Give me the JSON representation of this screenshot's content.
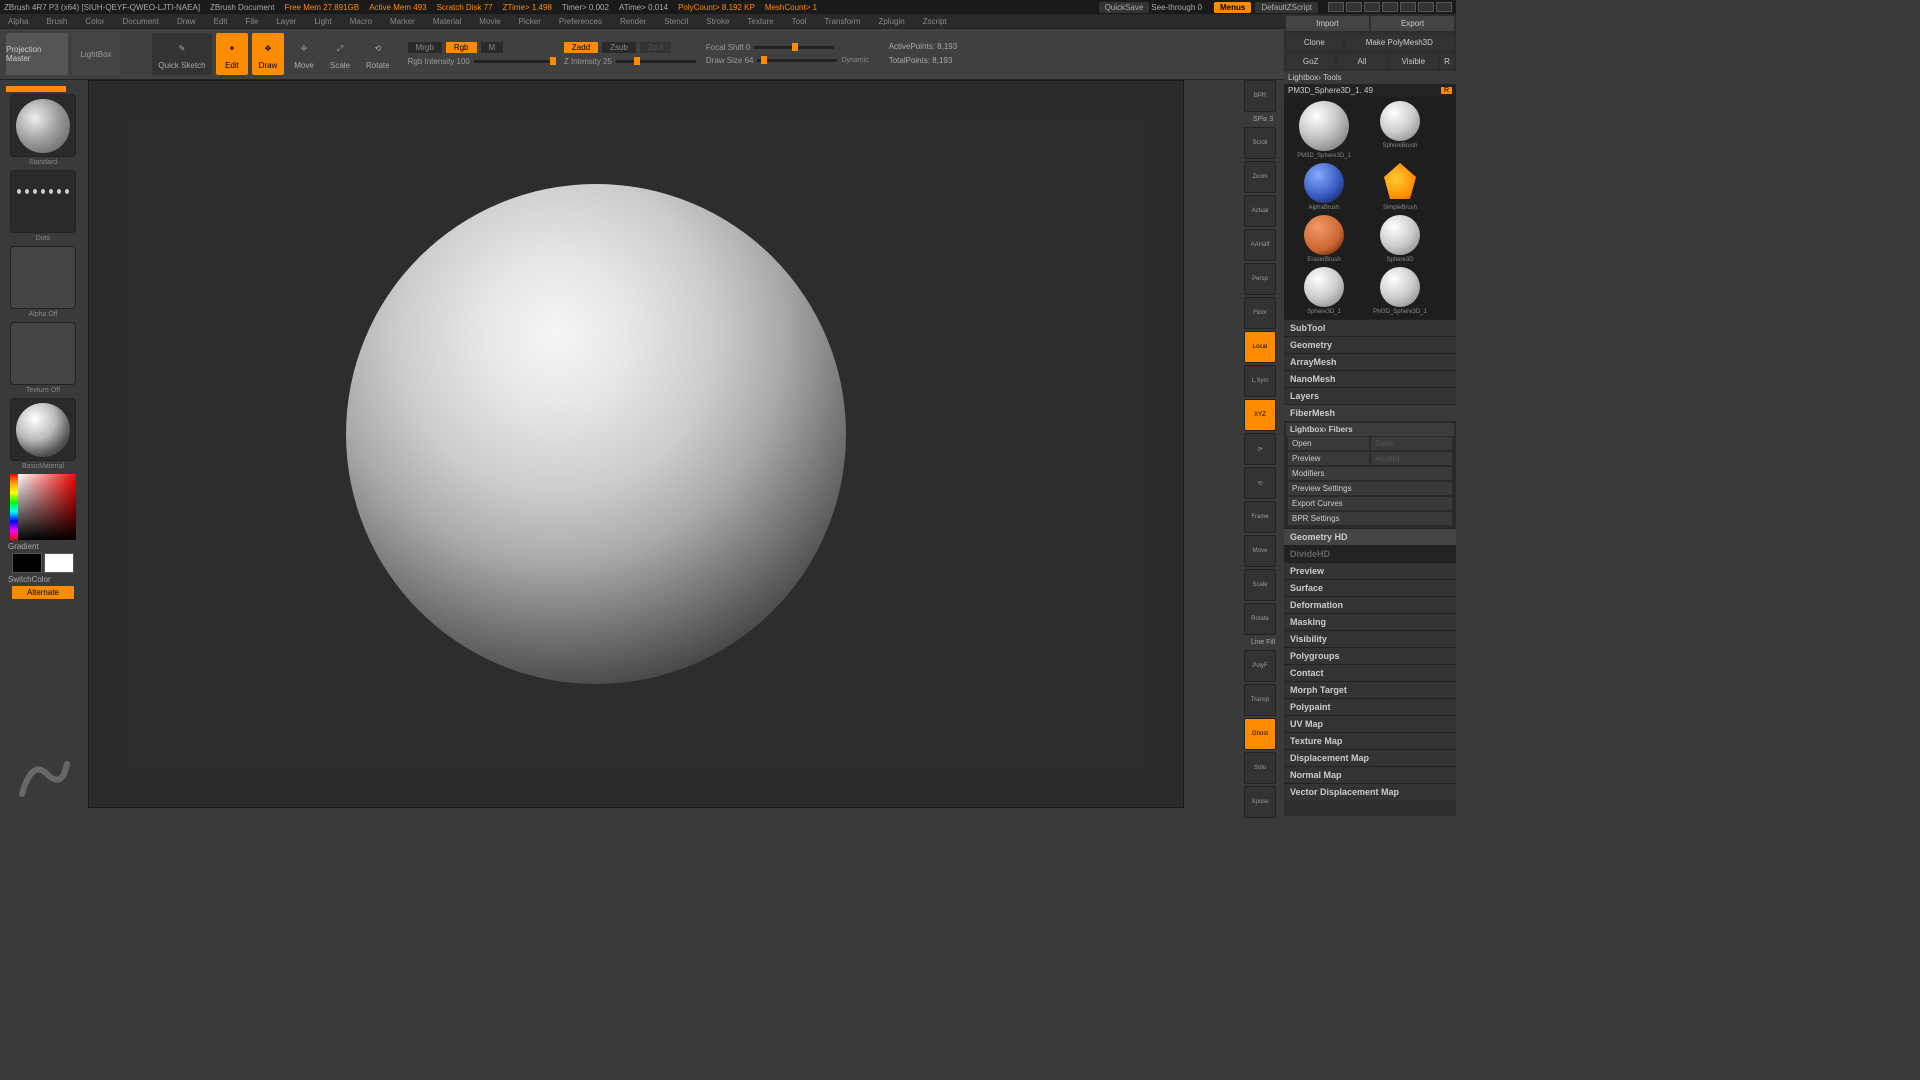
{
  "titlebar": {
    "app": "ZBrush 4R7 P3 (x64) [SIUH-QEYF-QWEO-LJTI-NAEA]",
    "doc": "ZBrush Document",
    "free_mem": "Free Mem 27.891GB",
    "active_mem": "Active Mem 493",
    "scratch": "Scratch Disk 77",
    "ztime": "ZTime> 1.498",
    "timer": "Timer> 0.002",
    "atime": "ATime> 0.014",
    "polycount": "PolyCount> 8.192 KP",
    "meshcount": "MeshCount> 1",
    "quicksave": "QuickSave",
    "seethrough": "See-through  0",
    "menus": "Menus",
    "defaultscript": "DefaultZScript"
  },
  "menu": [
    "Alpha",
    "Brush",
    "Color",
    "Document",
    "Draw",
    "Edit",
    "File",
    "Layer",
    "Light",
    "Macro",
    "Marker",
    "Material",
    "Movie",
    "Picker",
    "Preferences",
    "Render",
    "Stencil",
    "Stroke",
    "Texture",
    "Tool",
    "Transform",
    "Zplugin",
    "Zscript"
  ],
  "toolbar": {
    "projection_master": "Projection Master",
    "lightbox": "LightBox",
    "quick_sketch": "Quick Sketch",
    "edit": "Edit",
    "draw": "Draw",
    "move": "Move",
    "scale": "Scale",
    "rotate": "Rotate",
    "mrgb": "Mrgb",
    "rgb": "Rgb",
    "m": "M",
    "rgb_intensity_label": "Rgb Intensity 100",
    "zadd": "Zadd",
    "zsub": "Zsub",
    "zcut": "Zcut",
    "z_intensity_label": "Z Intensity 25",
    "focal_shift": "Focal Shift 0",
    "draw_size": "Draw Size 64",
    "dynamic": "Dynamic",
    "active_points": "ActivePoints: 8,193",
    "total_points": "TotalPoints: 8,193"
  },
  "leftpanel": {
    "brush_label": "Standard",
    "stroke_label": "Dots",
    "alpha_label": "Alpha Off",
    "texture_label": "Texture Off",
    "material_label": "BasicMaterial",
    "gradient": "Gradient",
    "switchcolor": "SwitchColor",
    "alternate": "Alternate"
  },
  "shelf": {
    "spix": "SPix 3",
    "btns": [
      "BPR",
      "Scroll",
      "Zoom",
      "Actual",
      "AAHalf",
      "Persp",
      "Floor",
      "Local",
      "L.Sym",
      "XYZ",
      "",
      "",
      "Frame",
      "Move",
      "Scale",
      "Rotate",
      "PolyF",
      "Transp",
      "Ghost",
      "Solo",
      "Xpose"
    ],
    "line_fill": "Line Fill"
  },
  "rightpanel": {
    "import": "Import",
    "export": "Export",
    "clone": "Clone",
    "make_polymesh": "Make PolyMesh3D",
    "goz": "GoZ",
    "all": "All",
    "visible": "Visible",
    "r": "R",
    "lightbox_tools": "Lightbox› Tools",
    "tool_name": "PM3D_Sphere3D_1. 49",
    "tools": [
      {
        "label": "PM3D_Sphere3D_1",
        "col": "#ddd"
      },
      {
        "label": "SphereBrush",
        "col": "#ccc"
      },
      {
        "label": "AlphaBrush",
        "col": "#3355bb"
      },
      {
        "label": "SimpleBrush",
        "col": "#ffaa00"
      },
      {
        "label": "EraserBrush",
        "col": "#cc6633"
      },
      {
        "label": "Sphere3D",
        "col": "#ccc"
      },
      {
        "label": "Sphere3D_1",
        "col": "#ccc"
      },
      {
        "label": "PM3D_Sphere3D_1",
        "col": "#ccc"
      }
    ],
    "sections": [
      "SubTool",
      "Geometry",
      "ArrayMesh",
      "NanoMesh",
      "Layers",
      "FiberMesh"
    ],
    "fibermesh": {
      "header": "Lightbox› Fibers",
      "open": "Open",
      "save": "Save",
      "preview": "Preview",
      "accept": "Accept",
      "modifiers": "Modifiers",
      "preview_settings": "Preview Settings",
      "export_curves": "Export Curves",
      "bpr_settings": "BPR Settings"
    },
    "sections2": [
      "Geometry HD",
      "DivideHD",
      "Preview",
      "Surface",
      "Deformation",
      "Masking",
      "Visibility",
      "Polygroups",
      "Contact",
      "Morph Target",
      "Polypaint",
      "UV Map",
      "Texture Map",
      "Displacement Map",
      "Normal Map",
      "Vector Displacement Map"
    ]
  }
}
